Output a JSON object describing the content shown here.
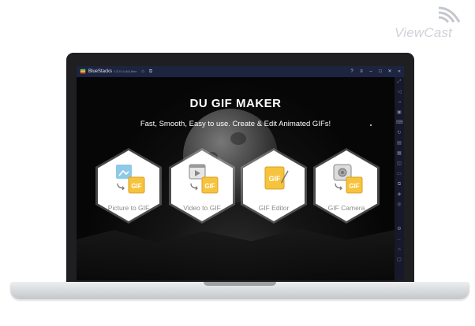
{
  "watermark": {
    "text": "ViewCast"
  },
  "window": {
    "app_name": "BlueStacks",
    "version": "4.210.10.(64)-Beta",
    "home_icon": "home-icon",
    "multi_icon": "multi-instance-icon",
    "controls": [
      "help-icon",
      "menu-icon",
      "minimize-icon",
      "restore-icon",
      "close-icon",
      "collapse-icon"
    ]
  },
  "sidebar": {
    "icons": [
      "expand-icon",
      "volume-up-icon",
      "volume-down-icon",
      "screen-record-icon",
      "keymap-icon",
      "rotate-icon",
      "install-apk-icon",
      "macro-icon",
      "screenshot-icon",
      "folder-icon",
      "copy-icon",
      "stack-icon",
      "sync-icon",
      "settings-icon",
      "back-icon",
      "home-icon",
      "recent-icon"
    ]
  },
  "app": {
    "title": "DU GIF MAKER",
    "subtitle": "Fast, Smooth, Easy to use. Create & Edit Animated GIFs!",
    "options": [
      {
        "label": "Picture to GIF",
        "icon": "picture-to-gif-icon",
        "badge": "GIF"
      },
      {
        "label": "Video to GIF",
        "icon": "video-to-gif-icon",
        "badge": "GIF"
      },
      {
        "label": "GIF Editor",
        "icon": "gif-editor-icon",
        "badge": "GIF"
      },
      {
        "label": "GIF Camera",
        "icon": "gif-camera-icon",
        "badge": "GIF"
      }
    ]
  },
  "colors": {
    "gif_yellow": "#f6c33d",
    "gif_yellow_dark": "#d9a21f",
    "tile_blue": "#8ec9e8",
    "titlebar": "#1c2440"
  }
}
